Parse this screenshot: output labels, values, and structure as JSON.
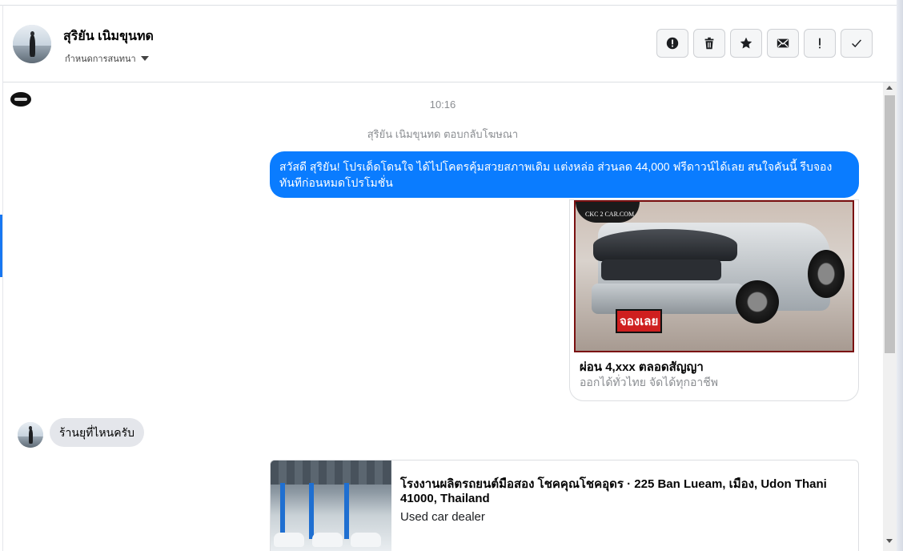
{
  "header": {
    "name": "สุริยัน เนิมขุนทด",
    "subtitle": "กำหนดการสนทนา",
    "actions": [
      {
        "name": "report-icon",
        "symbol": "!"
      },
      {
        "name": "trash-icon"
      },
      {
        "name": "star-icon"
      },
      {
        "name": "mail-icon"
      },
      {
        "name": "exclamation-icon",
        "symbol": "!"
      },
      {
        "name": "check-icon"
      }
    ]
  },
  "chat": {
    "timestamp": "10:16",
    "reply_note": "สุริยัน เนิมขุนทด ตอบกลับโฆษณา",
    "outgoing_message": "สวัสดี สุริยัน! โปรเด็ดโดนใจ ได้ไปโคตรคุ้มสวยสภาพเดิม แต่งหล่อ  ส่วนลด 44,000 ฟรีดาวน์ได้เลย  สนใจคันนี้ รีบจองทันทีก่อนหมดโปรโมชั่น",
    "ad_card": {
      "logo_text": "CKC 2 CAR.COM",
      "stamp_text": "จองเลย",
      "title": "ผ่อน 4,xxx ตลอดสัญญา",
      "subtitle": "ออกได้ทั่วไทย จัดได้ทุกอาชีพ"
    },
    "incoming_message": "ร้านยุที่ไหนครับ",
    "location_card": {
      "title": "โรงงานผลิตรถยนต์มือสอง โชคคุณโชคอุดร · 225 Ban Lueam, เมือง, Udon Thani 41000, Thailand",
      "subtitle": "Used car dealer"
    }
  },
  "colors": {
    "accent": "#0a7cff",
    "incoming_bubble": "#e4e6eb",
    "muted_text": "#8a8d91"
  }
}
